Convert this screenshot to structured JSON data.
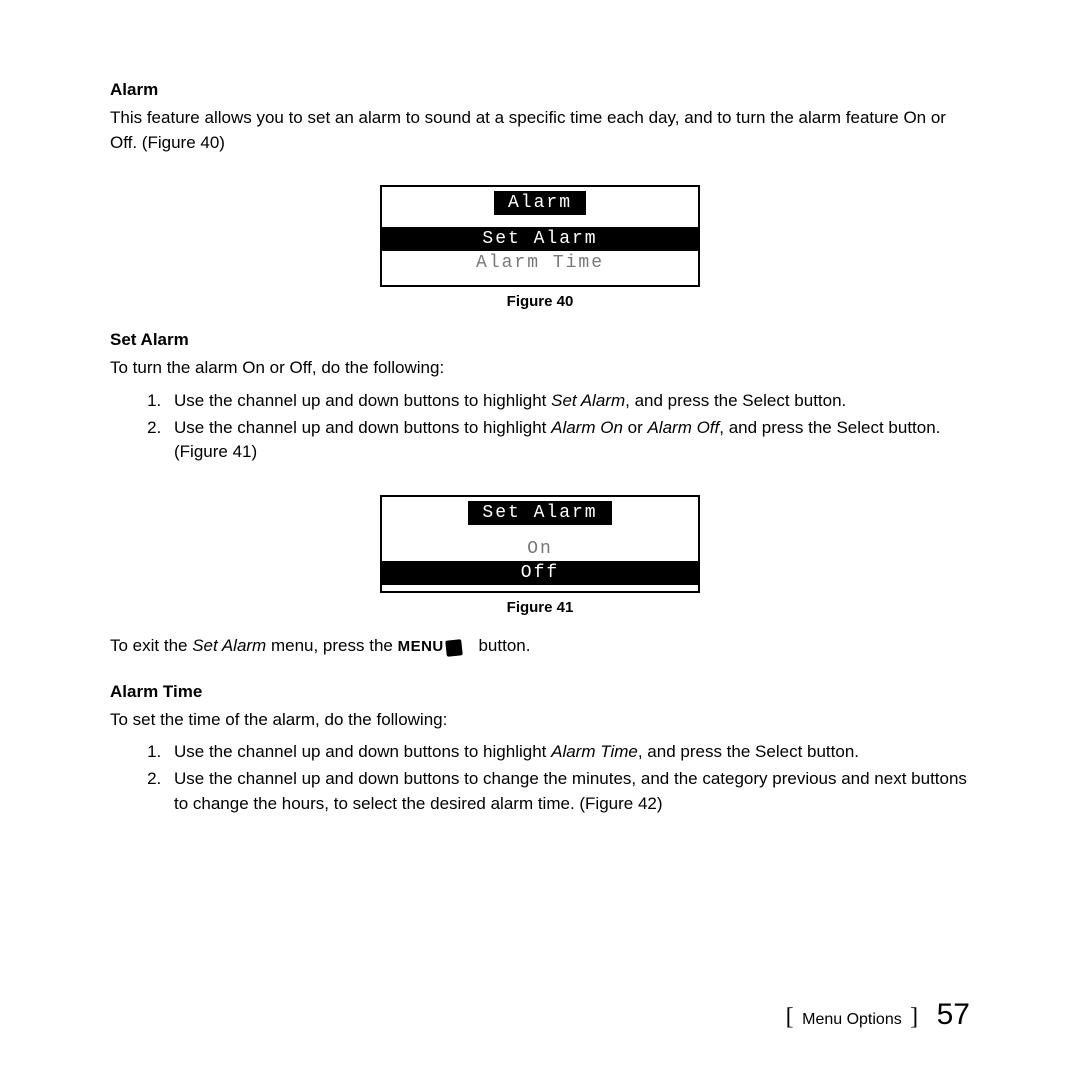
{
  "alarm": {
    "title": "Alarm",
    "intro": "This feature allows you to set an alarm to sound at a specific time each day, and to turn the alarm feature On or Off. (Figure 40)"
  },
  "figure40": {
    "title": "Alarm",
    "row_highlight": "Set Alarm",
    "row_plain": "Alarm Time",
    "caption": "Figure 40"
  },
  "setAlarm": {
    "title": "Set Alarm",
    "intro": "To turn the alarm On or Off, do the following:",
    "steps": [
      {
        "pre": "Use the channel up and down buttons to highlight ",
        "em": "Set Alarm",
        "post": ", and press the Select button."
      },
      {
        "pre": "Use the channel up and down buttons to highlight ",
        "em": "Alarm On",
        "mid": " or ",
        "em2": "Alarm Off",
        "post": ", and press the Select button. (Figure 41)"
      }
    ]
  },
  "figure41": {
    "title": "Set Alarm",
    "row_plain": "On",
    "row_highlight": "Off",
    "caption": "Figure 41"
  },
  "exitLine": {
    "pre": "To exit the ",
    "em": "Set Alarm",
    "mid": " menu, press the ",
    "btn": "MENU",
    "post": " button."
  },
  "alarmTime": {
    "title": "Alarm Time",
    "intro": "To set the time of the alarm, do the following:",
    "steps": [
      {
        "pre": "Use the channel up and down buttons to highlight ",
        "em": "Alarm Time",
        "post": ", and press the Select button."
      },
      {
        "pre": "Use the channel up and down buttons to change the minutes, and the category previous and next buttons to change the hours, to select the desired alarm time. (Figure 42)"
      }
    ]
  },
  "footer": {
    "label": "Menu Options",
    "page": "57"
  }
}
